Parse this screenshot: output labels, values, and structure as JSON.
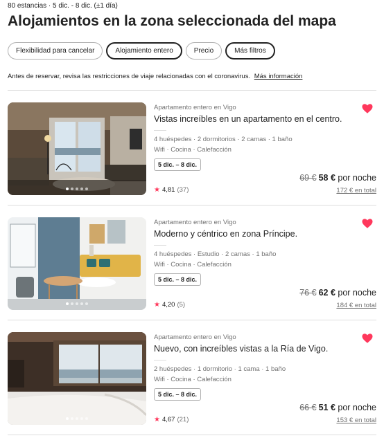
{
  "header": {
    "meta": "80 estancias · 5 dic. - 8 dic. (±1 día)",
    "title": "Alojamientos en la zona seleccionada del mapa"
  },
  "filters": [
    {
      "label": "Flexibilidad para cancelar",
      "active": false
    },
    {
      "label": "Alojamiento entero",
      "active": true
    },
    {
      "label": "Precio",
      "active": false
    },
    {
      "label": "Más filtros",
      "active": true
    }
  ],
  "notice": {
    "text": "Antes de reservar, revisa las restricciones de viaje relacionadas con el coronavirus.",
    "link": "Más información"
  },
  "colors": {
    "accent": "#ff385c",
    "text": "#222222",
    "muted": "#717171"
  },
  "listings": [
    {
      "subtitle": "Apartamento entero en Vigo",
      "name": "Vistas increíbles en un apartamento en el centro.",
      "details": "4 huéspedes · 2 dormitorios · 2 camas · 1 baño",
      "amenities": "Wifi · Cocina · Calefacción",
      "dates": "5 dic. – 8 dic.",
      "rating": "4,81",
      "reviews": "(37)",
      "old_price": "69 €",
      "price": "58 €",
      "per_night": "por noche",
      "total": "172 € en total",
      "favorite": true,
      "photo_index": 1
    },
    {
      "subtitle": "Apartamento entero en Vigo",
      "name": "Moderno y céntrico en zona Príncipe.",
      "details": "4 huéspedes · Estudio · 2 camas · 1 baño",
      "amenities": "Wifi · Cocina · Calefacción",
      "dates": "5 dic. – 8 dic.",
      "rating": "4,20",
      "reviews": "(5)",
      "old_price": "76 €",
      "price": "62 €",
      "per_night": "por noche",
      "total": "184 € en total",
      "favorite": true,
      "photo_index": 1
    },
    {
      "subtitle": "Apartamento entero en Vigo",
      "name": "Nuevo, con increíbles vistas a la Ría de Vigo.",
      "details": "2 huéspedes · 1 dormitorio · 1 cama · 1 baño",
      "amenities": "Wifi · Cocina · Calefacción",
      "dates": "5 dic. – 8 dic.",
      "rating": "4,67",
      "reviews": "(21)",
      "old_price": "66 €",
      "price": "51 €",
      "per_night": "por noche",
      "total": "153 € en total",
      "favorite": true,
      "photo_index": 1
    }
  ]
}
